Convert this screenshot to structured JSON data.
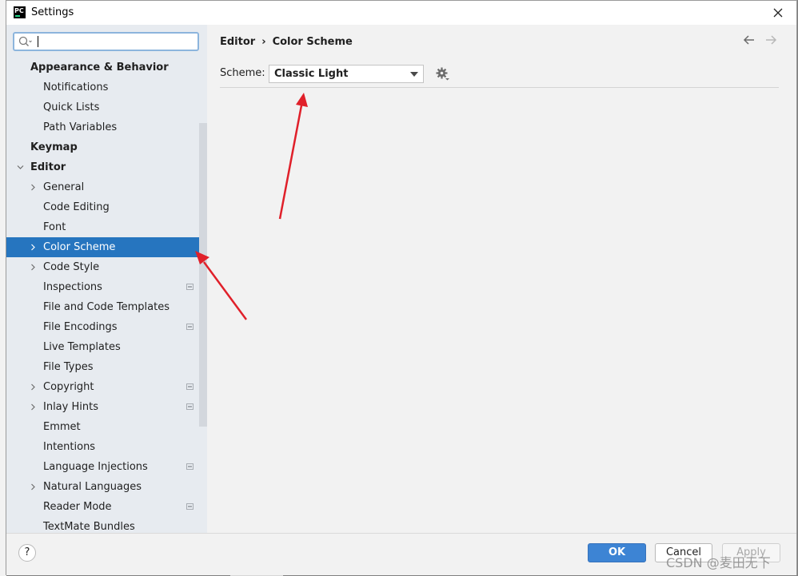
{
  "window": {
    "title": "Settings"
  },
  "search": {
    "value": "",
    "placeholder": ""
  },
  "sidebar": {
    "items": [
      {
        "label": "Appearance & Behavior",
        "level": 0,
        "expandable": false,
        "badge": false
      },
      {
        "label": "Notifications",
        "level": 1,
        "expandable": false,
        "badge": false
      },
      {
        "label": "Quick Lists",
        "level": 1,
        "expandable": false,
        "badge": false
      },
      {
        "label": "Path Variables",
        "level": 1,
        "expandable": false,
        "badge": false
      },
      {
        "label": "Keymap",
        "level": 0,
        "expandable": false,
        "badge": false
      },
      {
        "label": "Editor",
        "level": 0,
        "expandable": true,
        "expanded": true,
        "badge": false
      },
      {
        "label": "General",
        "level": 1,
        "expandable": true,
        "badge": false
      },
      {
        "label": "Code Editing",
        "level": 1,
        "expandable": false,
        "badge": false
      },
      {
        "label": "Font",
        "level": 1,
        "expandable": false,
        "badge": false
      },
      {
        "label": "Color Scheme",
        "level": 1,
        "expandable": true,
        "badge": false,
        "selected": true
      },
      {
        "label": "Code Style",
        "level": 1,
        "expandable": true,
        "badge": false
      },
      {
        "label": "Inspections",
        "level": 1,
        "expandable": false,
        "badge": true
      },
      {
        "label": "File and Code Templates",
        "level": 1,
        "expandable": false,
        "badge": false
      },
      {
        "label": "File Encodings",
        "level": 1,
        "expandable": false,
        "badge": true
      },
      {
        "label": "Live Templates",
        "level": 1,
        "expandable": false,
        "badge": false
      },
      {
        "label": "File Types",
        "level": 1,
        "expandable": false,
        "badge": false
      },
      {
        "label": "Copyright",
        "level": 1,
        "expandable": true,
        "badge": true
      },
      {
        "label": "Inlay Hints",
        "level": 1,
        "expandable": true,
        "badge": true
      },
      {
        "label": "Emmet",
        "level": 1,
        "expandable": false,
        "badge": false
      },
      {
        "label": "Intentions",
        "level": 1,
        "expandable": false,
        "badge": false
      },
      {
        "label": "Language Injections",
        "level": 1,
        "expandable": false,
        "badge": true
      },
      {
        "label": "Natural Languages",
        "level": 1,
        "expandable": true,
        "badge": false
      },
      {
        "label": "Reader Mode",
        "level": 1,
        "expandable": false,
        "badge": true
      },
      {
        "label": "TextMate Bundles",
        "level": 1,
        "expandable": false,
        "badge": false
      }
    ]
  },
  "breadcrumb": {
    "parent": "Editor",
    "separator": "›",
    "current": "Color Scheme"
  },
  "scheme": {
    "label": "Scheme:",
    "value": "Classic Light"
  },
  "footer": {
    "help": "?",
    "ok": "OK",
    "cancel": "Cancel",
    "apply": "Apply"
  },
  "watermark": "CSDN @麦田无下",
  "colors": {
    "selection": "#2675bf",
    "ok_button": "#3d84d4",
    "annotation_arrow": "#e0202a"
  }
}
